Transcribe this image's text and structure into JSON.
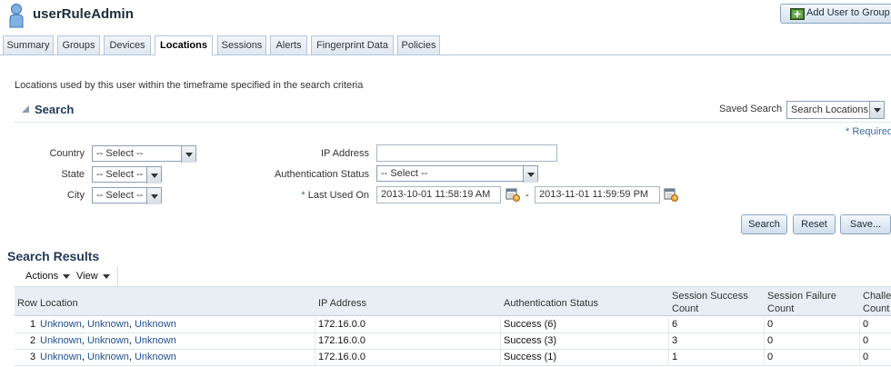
{
  "header": {
    "title": "userRuleAdmin",
    "add_button": "Add User to Group"
  },
  "tabs": [
    {
      "label": "Summary"
    },
    {
      "label": "Groups"
    },
    {
      "label": "Devices"
    },
    {
      "label": "Locations"
    },
    {
      "label": "Sessions"
    },
    {
      "label": "Alerts"
    },
    {
      "label": "Fingerprint Data"
    },
    {
      "label": "Policies"
    }
  ],
  "active_tab": "Locations",
  "description": "Locations used by this user within the timeframe specified in the search criteria",
  "search": {
    "title": "Search",
    "saved_search_label": "Saved Search",
    "saved_search_value": "Search Locations",
    "required_note": "Required",
    "fields": {
      "country_label": "Country",
      "country_value": "-- Select --",
      "state_label": "State",
      "state_value": "-- Select --",
      "city_label": "City",
      "city_value": "-- Select --",
      "ip_label": "IP Address",
      "ip_value": "",
      "auth_label": "Authentication Status",
      "auth_value": "-- Select --",
      "last_used_label": "Last Used On",
      "last_used_from": "2013-10-01 11:58:19 AM",
      "range_sep": "-",
      "last_used_to": "2013-11-01 11:59:59 PM"
    },
    "buttons": {
      "search": "Search",
      "reset": "Reset",
      "save": "Save..."
    }
  },
  "results": {
    "title": "Search Results",
    "toolbar": {
      "actions": "Actions",
      "view": "View"
    },
    "columns": {
      "row": "Row",
      "location": "Location",
      "ip": "IP Address",
      "auth": "Authentication Status",
      "success_1": "Session Success",
      "success_2": "Count",
      "failure_1": "Session Failure",
      "failure_2": "Count",
      "challenge_1": "Challe",
      "challenge_2": "Count"
    },
    "rows": [
      {
        "num": "1",
        "loc_a": "Unknown",
        "loc_b": "Unknown",
        "loc_c": "Unknown",
        "sep": ",",
        "ip": "172.16.0.0",
        "auth": "Success (6)",
        "success": "6",
        "failure": "0",
        "challenge": "0"
      },
      {
        "num": "2",
        "loc_a": "Unknown",
        "loc_b": "Unknown",
        "loc_c": "Unknown",
        "sep": ",",
        "ip": "172.16.0.0",
        "auth": "Success (3)",
        "success": "3",
        "failure": "0",
        "challenge": "0"
      },
      {
        "num": "3",
        "loc_a": "Unknown",
        "loc_b": "Unknown",
        "loc_c": "Unknown",
        "sep": ",",
        "ip": "172.16.0.0",
        "auth": "Success (1)",
        "success": "1",
        "failure": "0",
        "challenge": "0"
      }
    ]
  },
  "colors": {
    "accent": "#23395b",
    "link": "#1f4f8f",
    "header_bg": "#e8eef4"
  }
}
